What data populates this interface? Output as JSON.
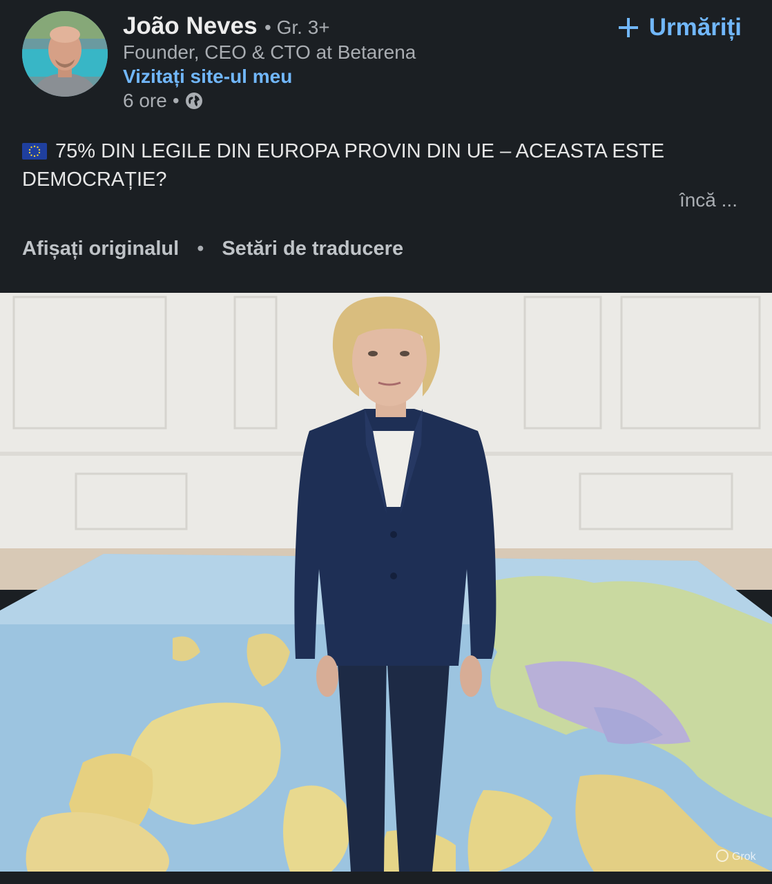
{
  "post": {
    "author": {
      "name": "João Neves",
      "degree": "• Gr. 3+",
      "headline": "Founder, CEO & CTO at Betarena",
      "site_link": "Vizitați site-ul meu",
      "time": "6 ore",
      "time_separator": "•",
      "visibility_icon": "globe-icon"
    },
    "follow_button": {
      "label": "Urmăriți",
      "icon": "plus-icon"
    },
    "text": "75% DIN LEGILE DIN EUROPA PROVIN DIN UE – ACEASTA ESTE DEMOCRAȚIE?",
    "flag_emoji": "eu-flag",
    "see_more": "încă ...",
    "translation": {
      "show_original": "Afișați originalul",
      "separator": "•",
      "settings": "Setări de traducere"
    },
    "image": {
      "description_icon": "post-image",
      "watermark": "Grok"
    }
  },
  "colors": {
    "background": "#1b1f23",
    "link_blue": "#71b7fb",
    "secondary_text": "#a9adb2",
    "primary_text": "#e6e6e6"
  }
}
